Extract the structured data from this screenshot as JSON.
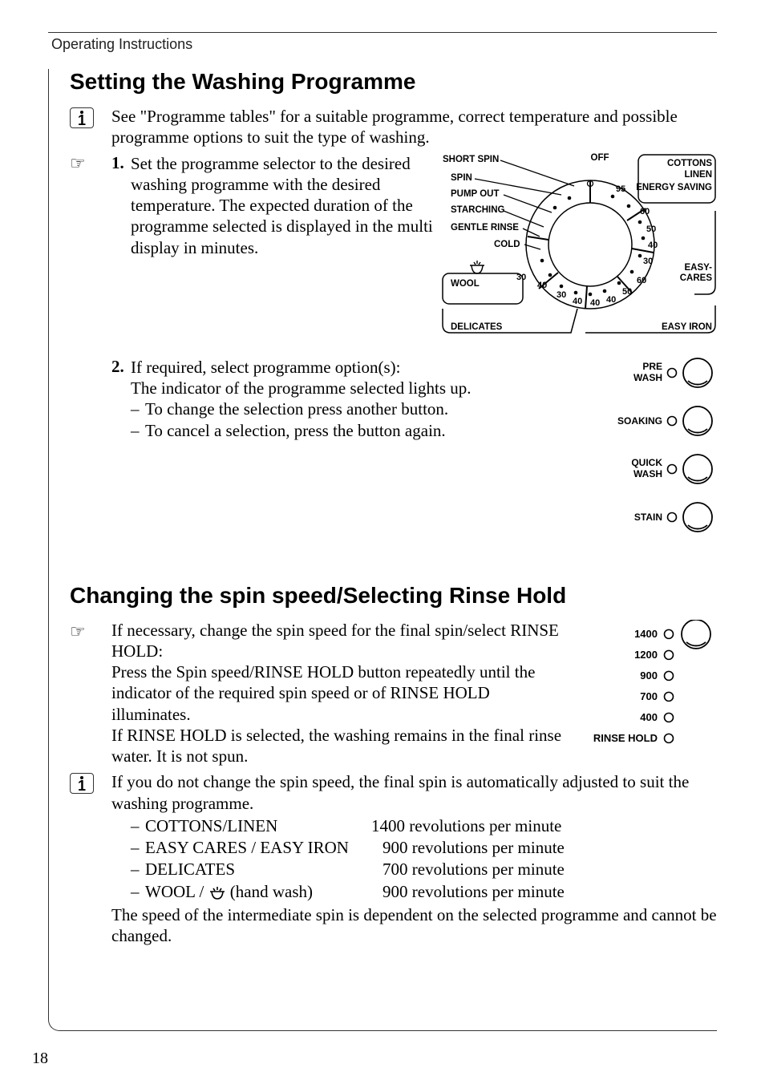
{
  "running_head": "Operating Instructions",
  "page_number": "18",
  "h1": "Setting the Washing Programme",
  "intro": "See \"Programme tables\" for a suitable programme, correct temperature and possible programme options to suit the type of washing.",
  "step1": {
    "num": "1.",
    "body": "Set the programme selector to the desired washing programme with the desired temperature. The expected duration of the programme selected is displayed in the multi display in minutes."
  },
  "dial": {
    "labels": {
      "short_spin": "SHORT SPIN",
      "spin": "SPIN",
      "pump_out": "PUMP OUT",
      "starching": "STARCHING",
      "gentle_rinse": "GENTLE RINSE",
      "cold": "COLD",
      "wool": "WOOL",
      "delicates": "DELICATES",
      "off": "OFF",
      "cottons": "COTTONS",
      "linen": "LINEN",
      "energy_saving": "ENERGY SAVING",
      "easy_cares": "EASY-\nCARES",
      "easy_iron": "EASY IRON"
    },
    "temps": [
      "95",
      "60",
      "50",
      "40",
      "30",
      "60",
      "50",
      "40",
      "30",
      "40",
      "40",
      "40",
      "30",
      "30"
    ]
  },
  "step2": {
    "num": "2.",
    "lead": "If required, select programme option(s):",
    "line": "The indicator of the programme selected lights up.",
    "b1": "To change the selection press another button.",
    "b2": "To cancel a selection, press the button again."
  },
  "option_buttons": {
    "pre_wash": "PRE\nWASH",
    "soaking": "SOAKING",
    "quick_wash": "QUICK\nWASH",
    "stain": "STAIN"
  },
  "h2": "Changing the spin speed/Selecting Rinse Hold",
  "spin_para": {
    "l1": "If necessary, change the spin speed for the final spin/select RINSE HOLD:",
    "l2": "Press the Spin speed/RINSE HOLD button repeatedly until the indicator of the required spin speed or of RINSE HOLD illuminates.",
    "l3": "If RINSE HOLD is selected, the washing remains in the final rinse water. It is not spun."
  },
  "spin_labels": {
    "s1400": "1400",
    "s1200": "1200",
    "s900": "900",
    "s700": "700",
    "s400": "400",
    "rinse_hold": "RINSE HOLD"
  },
  "info2_lead": "If you do not change the spin speed, the final spin is automatically adjusted to suit the washing programme.",
  "defs": [
    {
      "label": "COTTONS/LINEN",
      "val": "1400 revolutions per minute"
    },
    {
      "label": "EASY CARES / EASY IRON",
      "val": "900 revolutions per minute"
    },
    {
      "label": "DELICATES",
      "val": "700 revolutions per minute"
    },
    {
      "label_prefix": "WOOL /",
      "label_suffix": " (hand wash)",
      "val": "900 revolutions per minute"
    }
  ],
  "tail": "The speed of the intermediate spin is dependent on the selected programme and cannot be changed."
}
